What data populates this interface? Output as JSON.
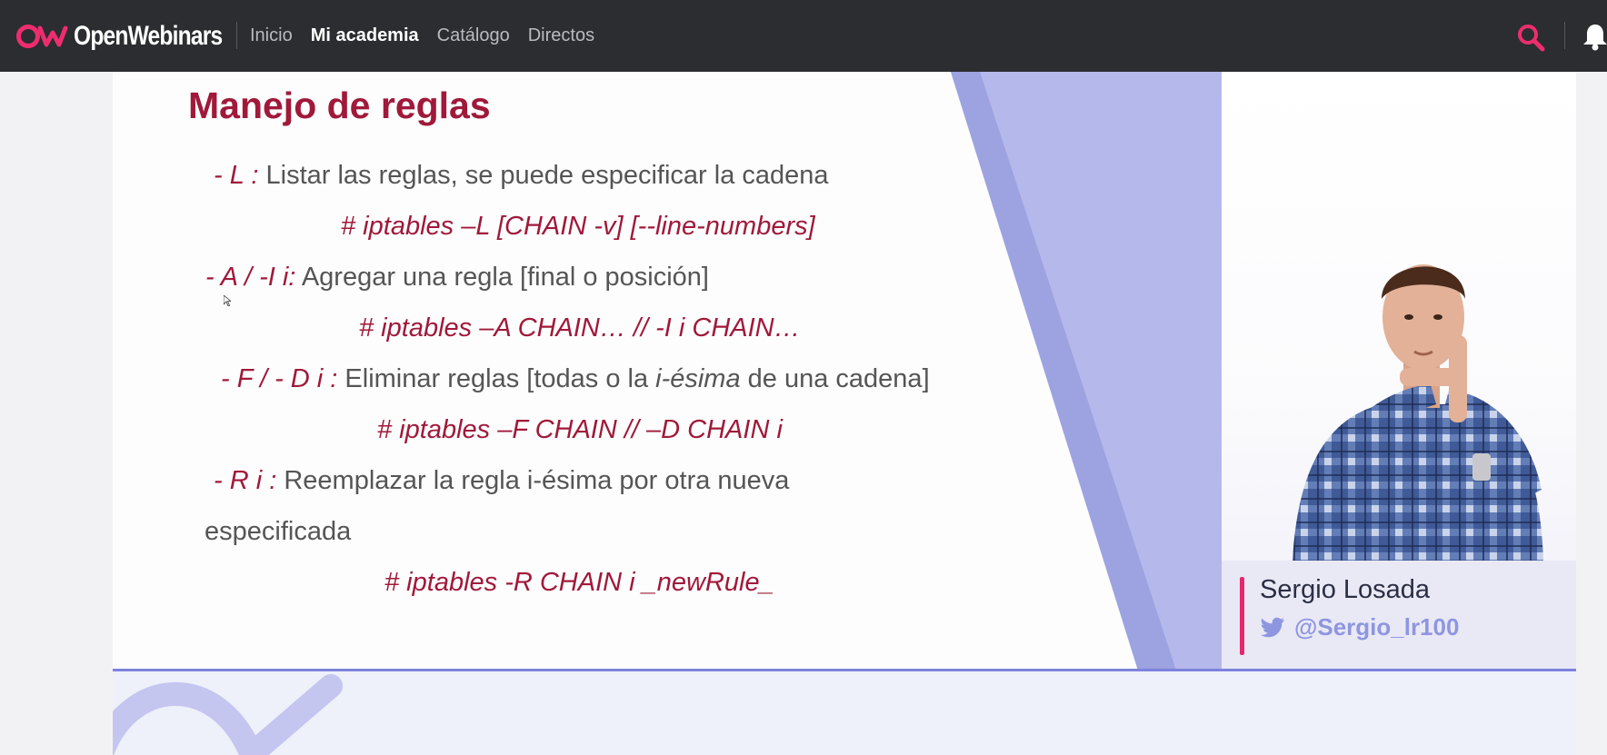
{
  "brand": {
    "name": "OpenWebinars",
    "accent": "#ee2d6e"
  },
  "nav": {
    "items": [
      {
        "label": "Inicio",
        "active": false
      },
      {
        "label": "Mi academia",
        "active": true
      },
      {
        "label": "Catálogo",
        "active": false
      },
      {
        "label": "Directos",
        "active": false
      }
    ],
    "search_icon": "search-icon",
    "bell_icon": "bell-icon"
  },
  "slide": {
    "title": "Manejo de reglas",
    "rules": [
      {
        "flag": "- L :",
        "text": " Listar las reglas, se puede especificar la cadena"
      },
      {
        "cmd": "# iptables –L [CHAIN -v] [--line-numbers]"
      },
      {
        "flag": "- A / -I i:",
        "text": " Agregar una regla [final o posición]"
      },
      {
        "cmd": "# iptables –A CHAIN… // -I i CHAIN…"
      },
      {
        "flag": "- F / - D i :",
        "text_before": " Eliminar reglas [todas o la ",
        "text_em": "i-ésima",
        "text_after": " de una cadena]"
      },
      {
        "cmd": "# iptables –F CHAIN // –D CHAIN i"
      },
      {
        "flag": "- R i :",
        "text": " Reemplazar la regla i-ésima por otra nueva"
      },
      {
        "text": "especificada"
      },
      {
        "cmd": "# iptables -R CHAIN i _newRule_"
      }
    ]
  },
  "presenter": {
    "name": "Sergio Losada",
    "handle": "@Sergio_lr100",
    "twitter_icon": "twitter-icon"
  },
  "colors": {
    "topbar": "#2b2d30",
    "slide_red": "#a0193a",
    "stripe_light": "#b5b8ea",
    "stripe_dark": "#9da2e0",
    "handle": "#8f96e0"
  }
}
